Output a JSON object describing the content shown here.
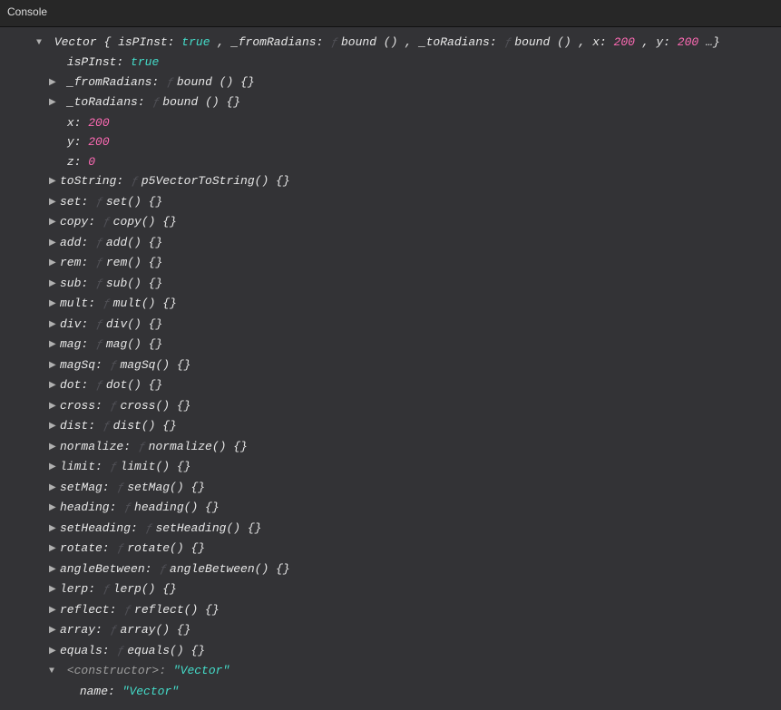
{
  "title": "Console",
  "header": {
    "className": "Vector",
    "open": "{",
    "k_isPInst": "isPInst:",
    "v_isPInst": "true",
    "sep1": ", ",
    "k_from": "_fromRadians:",
    "v_from": "bound ()",
    "sep2": ", ",
    "k_to": "_toRadians:",
    "v_to": "bound ()",
    "sep3": ", ",
    "k_x": "x:",
    "v_x": "200",
    "sep4": ", ",
    "k_y": "y:",
    "v_y": "200",
    "ellips": "…}"
  },
  "props": {
    "isPInst_k": "isPInst:",
    "isPInst_v": "true",
    "from_k": "_fromRadians:",
    "from_v": "bound () {}",
    "to_k": "_toRadians:",
    "to_v": "bound () {}",
    "x_k": "x:",
    "x_v": "200",
    "y_k": "y:",
    "y_v": "200",
    "z_k": "z:",
    "z_v": "0"
  },
  "methods": [
    {
      "k": "toString:",
      "v": "p5VectorToString() {}"
    },
    {
      "k": "set:",
      "v": "set() {}"
    },
    {
      "k": "copy:",
      "v": "copy() {}"
    },
    {
      "k": "add:",
      "v": "add() {}"
    },
    {
      "k": "rem:",
      "v": "rem() {}"
    },
    {
      "k": "sub:",
      "v": "sub() {}"
    },
    {
      "k": "mult:",
      "v": "mult() {}"
    },
    {
      "k": "div:",
      "v": "div() {}"
    },
    {
      "k": "mag:",
      "v": "mag() {}"
    },
    {
      "k": "magSq:",
      "v": "magSq() {}"
    },
    {
      "k": "dot:",
      "v": "dot() {}"
    },
    {
      "k": "cross:",
      "v": "cross() {}"
    },
    {
      "k": "dist:",
      "v": "dist() {}"
    },
    {
      "k": "normalize:",
      "v": "normalize() {}"
    },
    {
      "k": "limit:",
      "v": "limit() {}"
    },
    {
      "k": "setMag:",
      "v": "setMag() {}"
    },
    {
      "k": "heading:",
      "v": "heading() {}"
    },
    {
      "k": "setHeading:",
      "v": "setHeading() {}"
    },
    {
      "k": "rotate:",
      "v": "rotate() {}"
    },
    {
      "k": "angleBetween:",
      "v": "angleBetween() {}"
    },
    {
      "k": "lerp:",
      "v": "lerp() {}"
    },
    {
      "k": "reflect:",
      "v": "reflect() {}"
    },
    {
      "k": "array:",
      "v": "array() {}"
    },
    {
      "k": "equals:",
      "v": "equals() {}"
    }
  ],
  "ctor": {
    "k": "<constructor>:",
    "v": "\"Vector\"",
    "name_k": "name:",
    "name_v": "\"Vector\""
  },
  "glyphs": {
    "down": "▼",
    "right": "▶",
    "f": "ƒ"
  }
}
